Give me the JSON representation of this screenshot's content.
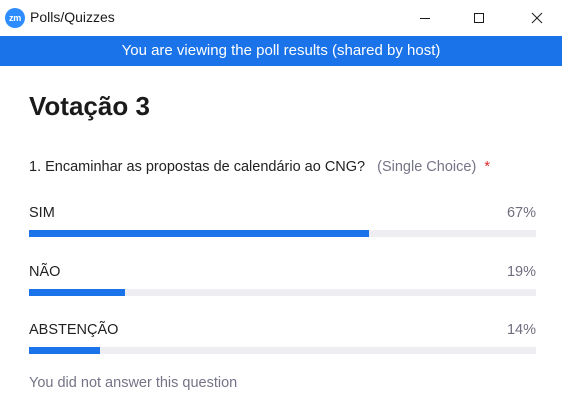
{
  "window": {
    "app_icon_text": "zm",
    "title": "Polls/Quizzes"
  },
  "banner": {
    "text": "You are viewing the poll results (shared by host)"
  },
  "poll": {
    "title": "Votação 3",
    "question": {
      "text": "1. Encaminhar as propostas de calendário ao CNG?",
      "type": "(Single Choice)",
      "required_mark": "*"
    },
    "options": [
      {
        "label": "SIM",
        "percent_label": "67%",
        "fraction": 0.67
      },
      {
        "label": "NÃO",
        "percent_label": "19%",
        "fraction": 0.19
      },
      {
        "label": "ABSTENÇÃO",
        "percent_label": "14%",
        "fraction": 0.14
      }
    ],
    "note": "You did not answer this question"
  },
  "colors": {
    "accent": "#1a73e8",
    "track": "#ededf2",
    "required": "#e02828"
  }
}
